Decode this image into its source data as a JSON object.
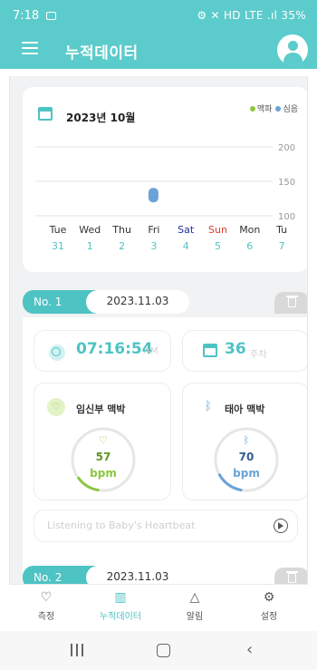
{
  "status_bar": {
    "time": "7:18",
    "right": "⚙ ✕ HD LTE .ıl 35%"
  },
  "app_bar": {
    "title": "누적데이터"
  },
  "chart": {
    "month_label": "2023년 10월",
    "legend": [
      {
        "name": "맥파",
        "color": "#8dc63f"
      },
      {
        "name": "심음",
        "color": "#6aa3d8"
      }
    ]
  },
  "chart_data": {
    "type": "scatter",
    "categories": [
      "Tue 31",
      "Wed 1",
      "Thu 2",
      "Fri 3",
      "Sat 4",
      "Sun 5",
      "Mon 6",
      "Tu 7"
    ],
    "days": [
      "Tue",
      "Wed",
      "Thu",
      "Fri",
      "Sat",
      "Sun",
      "Mon",
      "Tu"
    ],
    "dates": [
      "31",
      "1",
      "2",
      "3",
      "4",
      "5",
      "6",
      "7"
    ],
    "day_colors": [
      "#333333",
      "#333333",
      "#333333",
      "#333333",
      "#1f2fa6",
      "#e53935",
      "#333333",
      "#333333"
    ],
    "y_ticks": [
      100,
      150,
      200
    ],
    "ylim": [
      100,
      200
    ],
    "grid": true,
    "legend_position": "top-right",
    "series": [
      {
        "name": "심음",
        "color": "#6aa3d8",
        "points": [
          {
            "category": "Fri 3",
            "value": 130
          }
        ]
      }
    ]
  },
  "record1": {
    "no": "No. 1",
    "date": "2023.11.03",
    "time": "07:16:54",
    "time_suffix": "AM",
    "week": "36",
    "week_suffix": "주차",
    "mother_title": "임신부 맥박",
    "mother_value": "57",
    "mother_unit": "bpm",
    "mother_fraction": 0.12,
    "baby_title": "태아 맥박",
    "baby_value": "70",
    "baby_unit": "bpm",
    "baby_fraction": 0.14,
    "listen_text": "Listening to Baby's Heartbeat"
  },
  "record2": {
    "no": "No. 2",
    "date": "2023.11.03"
  },
  "bottom_nav": [
    {
      "label": "측정",
      "icon": "♡"
    },
    {
      "label": "누적데이터",
      "icon": "▥"
    },
    {
      "label": "알림",
      "icon": "△"
    },
    {
      "label": "설정",
      "icon": "⚙"
    }
  ],
  "colors": {
    "accent": "#4ec3c4",
    "header": "#5ccbcb",
    "mother": "#8dc63f",
    "baby": "#6aa3d8"
  }
}
